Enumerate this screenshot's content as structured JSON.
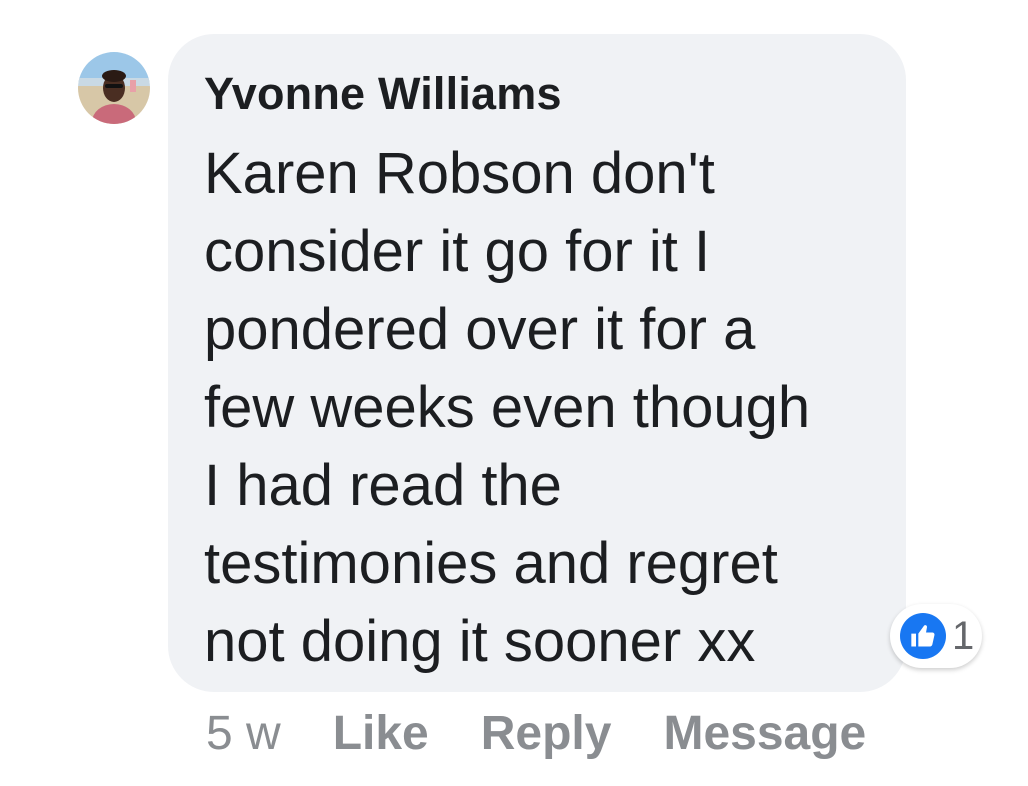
{
  "comment": {
    "author": "Yvonne Williams",
    "lines": [
      "Karen Robson don't",
      "consider it go for it I",
      "pondered over it for a",
      "few weeks even though",
      "I had read the",
      "testimonies and regret",
      "not doing it sooner xx"
    ],
    "reaction": {
      "icon": "thumbs-up-icon",
      "count": "1",
      "color": "#1877f2"
    },
    "time": "5 w",
    "actions": {
      "like": "Like",
      "reply": "Reply",
      "message": "Message"
    },
    "avatar_icon": "user-avatar"
  }
}
